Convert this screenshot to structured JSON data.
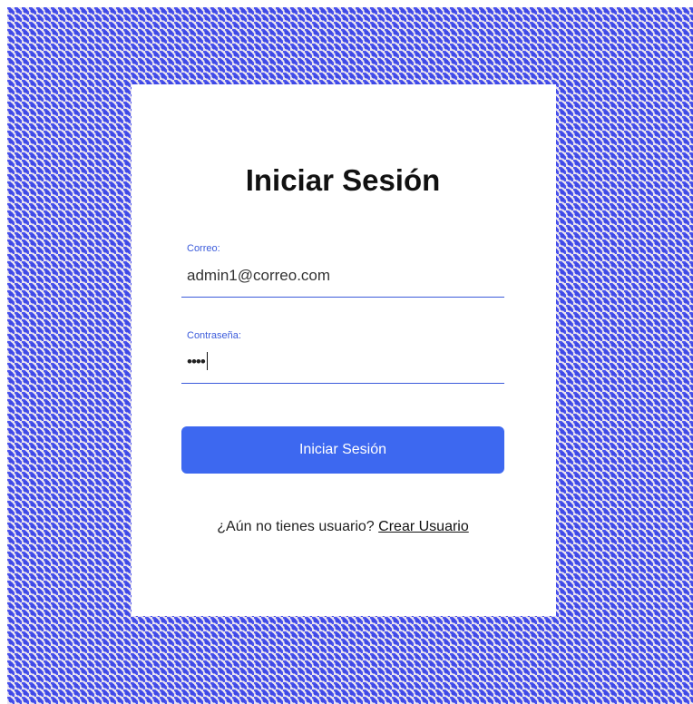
{
  "login": {
    "title": "Iniciar Sesión",
    "email_label": "Correo:",
    "email_value": "admin1@correo.com",
    "password_label": "Contraseña:",
    "password_masked": "••••",
    "submit_label": "Iniciar Sesión",
    "signup_prompt": "¿Aún no tienes usuario?",
    "signup_link": "Crear Usuario"
  },
  "colors": {
    "accent": "#3d68f0",
    "background_pattern": "#3f49e6",
    "card": "#ffffff"
  }
}
